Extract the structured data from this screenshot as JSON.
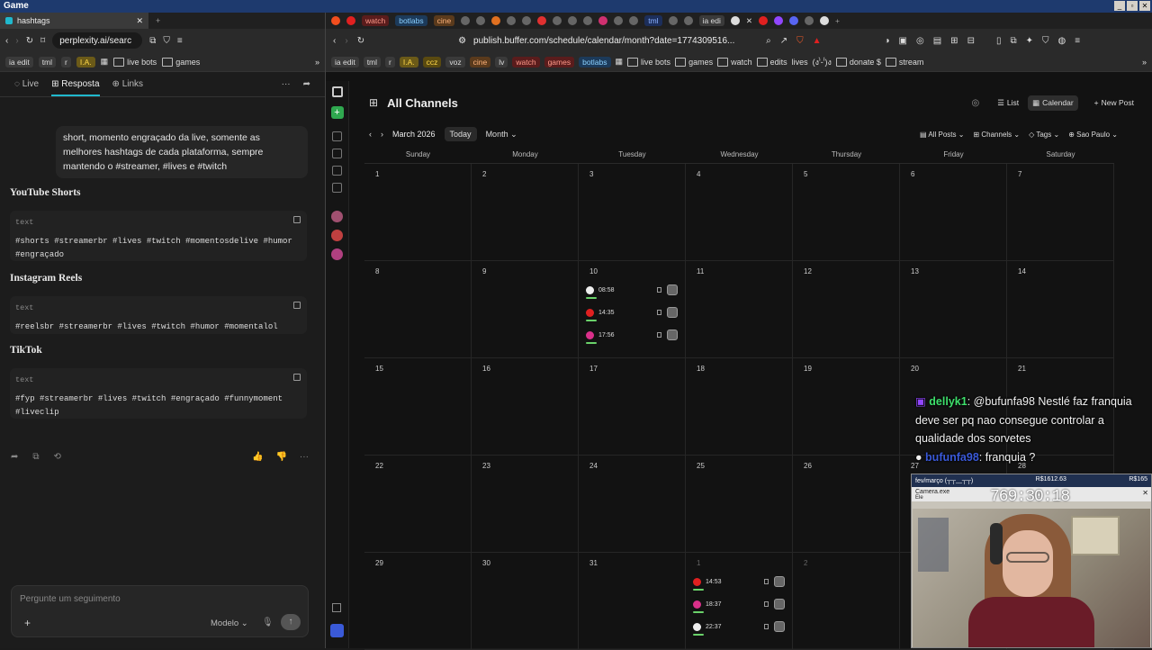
{
  "window": {
    "title": "Game"
  },
  "left": {
    "tab_title": "hashtags",
    "url": "perplexity.ai/searc",
    "bookmarks": [
      "ia edit",
      "tml",
      "r",
      "I.A.",
      "live bots",
      "games"
    ],
    "tabs": {
      "live": "Live",
      "resposta": "Resposta",
      "links": "Links"
    },
    "query": "short, momento engraçado da live, somente as melhores hashtags de cada plataforma, sempre mantendo o #streamer, #lives e #twitch",
    "sections": [
      {
        "title": "YouTube Shorts",
        "lang": "text",
        "code": "#shorts #streamerbr #lives #twitch #momentosdelive #humor #engraçado"
      },
      {
        "title": "Instagram Reels",
        "lang": "text",
        "code": "#reelsbr #streamerbr #lives #twitch #humor #momentalol"
      },
      {
        "title": "TikTok",
        "lang": "text",
        "code": "#fyp #streamerbr #lives #twitch #engraçado #funnymoment #liveclip"
      }
    ],
    "ask_placeholder": "Pergunte um seguimento",
    "model_label": "Modelo"
  },
  "right": {
    "tabs": [
      "watch",
      "botlabs",
      "cine",
      "tml",
      "ia edi"
    ],
    "url": "publish.buffer.com/schedule/calendar/month?date=1774309516...",
    "bookmarks": [
      "ia edit",
      "tml",
      "r",
      "I.A.",
      "ccz",
      "voz",
      "cine",
      "lv",
      "watch",
      "games",
      "botlabs",
      "live bots",
      "games",
      "watch",
      "edits",
      "lives",
      "(ง'̀-'́)ง",
      "donate $",
      "stream"
    ],
    "page_title": "All Channels",
    "view_list": "List",
    "view_calendar": "Calendar",
    "new_post": "New Post",
    "month_label": "March 2026",
    "today": "Today",
    "period": "Month",
    "filters": [
      "All Posts",
      "Channels",
      "Tags",
      "Sao Paulo"
    ],
    "weekdays": [
      "Sunday",
      "Monday",
      "Tuesday",
      "Wednesday",
      "Thursday",
      "Friday",
      "Saturday"
    ],
    "days": [
      [
        "1",
        "2",
        "3",
        "4",
        "5",
        "6",
        "7"
      ],
      [
        "8",
        "9",
        "10",
        "11",
        "12",
        "13",
        "14"
      ],
      [
        "15",
        "16",
        "17",
        "18",
        "19",
        "20",
        "21"
      ],
      [
        "22",
        "23",
        "24",
        "25",
        "26",
        "27",
        "28"
      ],
      [
        "29",
        "30",
        "31",
        "1",
        "2",
        "",
        ""
      ]
    ],
    "posts_10": [
      {
        "time": "08:58",
        "channel": "tiktok"
      },
      {
        "time": "14:35",
        "channel": "youtube"
      },
      {
        "time": "17:56",
        "channel": "instagram"
      }
    ],
    "posts_apr1": [
      {
        "time": "14:53",
        "channel": "youtube"
      },
      {
        "time": "18:37",
        "channel": "instagram"
      },
      {
        "time": "22:37",
        "channel": "tiktok"
      }
    ],
    "colors": {
      "youtube": "#e02020",
      "instagram": "#d9308a",
      "tiktok": "#eeeeee"
    }
  },
  "overlay": {
    "chat": [
      {
        "user": "dellyk1",
        "text": ": @bufunfa98 Nestlé faz franquia deve ser pq nao consegue controlar a qualidade dos sorvetes"
      },
      {
        "user": "bufunfa98",
        "text": ": franquia ?"
      }
    ],
    "cam_month": "fev/março",
    "cam_face": "(┬┬﹏┬┬)",
    "cam_amount_1": "R$1612.63",
    "cam_amount_2": "R$165",
    "cam_exe": "Camera.exe",
    "cam_sub": "Ele",
    "timer": "769:30:18"
  }
}
